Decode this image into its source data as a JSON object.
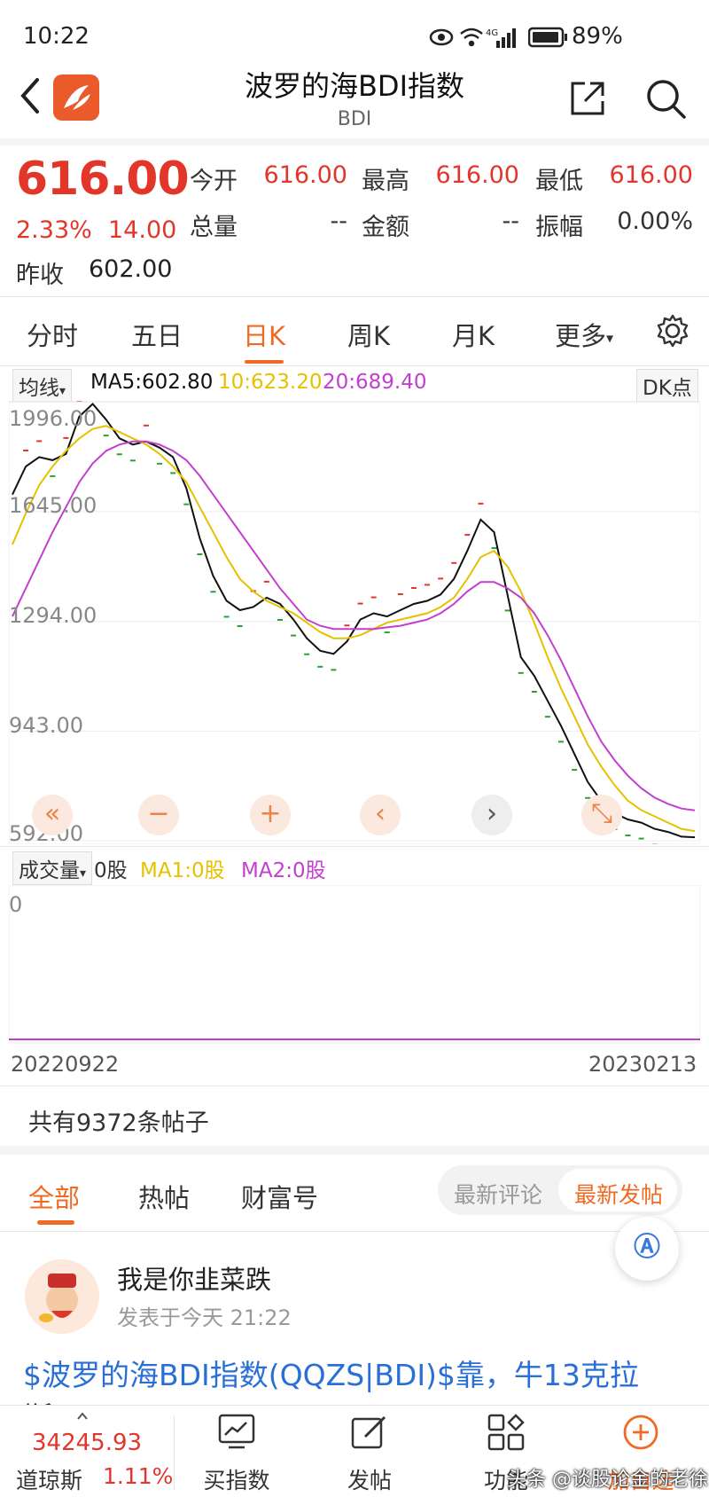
{
  "status_bar": {
    "time": "10:22",
    "network": "4G",
    "battery": "89%"
  },
  "header": {
    "title": "波罗的海BDI指数",
    "subtitle": "BDI"
  },
  "quote": {
    "price": "616.00",
    "change_pct": "2.33%",
    "change": "14.00",
    "prev_close_label": "昨收",
    "prev_close": "602.00",
    "open_label": "今开",
    "open": "616.00",
    "high_label": "最高",
    "high": "616.00",
    "low_label": "最低",
    "low": "616.00",
    "volume_label": "总量",
    "volume": "--",
    "amount_label": "金额",
    "amount": "--",
    "amplitude_label": "振幅",
    "amplitude": "0.00%"
  },
  "chart_tabs": [
    {
      "label": "分时"
    },
    {
      "label": "五日"
    },
    {
      "label": "日K"
    },
    {
      "label": "周K"
    },
    {
      "label": "月K"
    },
    {
      "label": "更多"
    }
  ],
  "ma_bar": {
    "selector": "均线",
    "ma5": "MA5:602.80",
    "ma10": "10:623.20",
    "ma20": "20:689.40",
    "dk_button": "DK点"
  },
  "vol_bar": {
    "selector": "成交量",
    "vol": "0股",
    "ma1": "MA1:0股",
    "ma2": "MA2:0股"
  },
  "colors": {
    "up": "#e2362b",
    "down": "#2aa137",
    "accent": "#f06a23",
    "ma5": "#111111",
    "ma10": "#e6c100",
    "ma20": "#c23fcf"
  },
  "chart_data": {
    "type": "line",
    "y_ticks": [
      "1996.00",
      "1645.00",
      "1294.00",
      "943.00",
      "592.00"
    ],
    "ylim": [
      592,
      2000
    ],
    "vol_ticks": [
      "0"
    ],
    "x_labels": [
      "20220922",
      "20230213"
    ],
    "series": [
      {
        "name": "MA5",
        "values": [
          1700,
          1790,
          1820,
          1810,
          1830,
          1950,
          1990,
          1940,
          1880,
          1860,
          1870,
          1850,
          1820,
          1720,
          1560,
          1440,
          1360,
          1330,
          1340,
          1370,
          1350,
          1300,
          1240,
          1200,
          1190,
          1230,
          1300,
          1320,
          1310,
          1330,
          1350,
          1360,
          1380,
          1430,
          1520,
          1620,
          1580,
          1380,
          1180,
          1120,
          1040,
          960,
          870,
          780,
          720,
          680,
          660,
          650,
          630,
          620,
          605,
          603
        ]
      },
      {
        "name": "10",
        "values": [
          1540,
          1640,
          1730,
          1790,
          1840,
          1880,
          1910,
          1920,
          1900,
          1880,
          1860,
          1830,
          1790,
          1740,
          1660,
          1580,
          1500,
          1430,
          1390,
          1360,
          1340,
          1320,
          1290,
          1260,
          1240,
          1240,
          1250,
          1270,
          1290,
          1300,
          1310,
          1320,
          1340,
          1370,
          1430,
          1500,
          1520,
          1470,
          1390,
          1290,
          1180,
          1080,
          990,
          900,
          830,
          770,
          720,
          690,
          670,
          650,
          630,
          623
        ]
      },
      {
        "name": "20",
        "values": [
          1310,
          1400,
          1490,
          1580,
          1660,
          1740,
          1800,
          1840,
          1860,
          1870,
          1870,
          1860,
          1840,
          1810,
          1760,
          1700,
          1640,
          1580,
          1520,
          1460,
          1400,
          1350,
          1300,
          1280,
          1270,
          1270,
          1270,
          1270,
          1275,
          1280,
          1290,
          1300,
          1320,
          1350,
          1390,
          1420,
          1420,
          1400,
          1370,
          1320,
          1250,
          1170,
          1080,
          990,
          910,
          850,
          800,
          760,
          730,
          710,
          695,
          689
        ]
      }
    ],
    "volume": [
      0
    ]
  },
  "chart_controls": [
    {
      "icon": "double-left-icon",
      "glyph": "«"
    },
    {
      "icon": "zoom-out-icon",
      "glyph": "−"
    },
    {
      "icon": "zoom-in-icon",
      "glyph": "+"
    },
    {
      "icon": "step-left-icon",
      "glyph": "‹"
    },
    {
      "icon": "step-right-icon",
      "glyph": "›"
    },
    {
      "icon": "expand-icon",
      "glyph": "⤡"
    }
  ],
  "posts": {
    "count_text": "共有9372条帖子",
    "tabs": [
      {
        "label": "全部"
      },
      {
        "label": "热帖"
      },
      {
        "label": "财富号"
      }
    ],
    "sort": {
      "latest_comment": "最新评论",
      "latest_post": "最新发帖"
    },
    "items": [
      {
        "author": "我是你韭菜跌",
        "meta": "发表于今天 21:22",
        "content": "$波罗的海BDI指数(QQZS|BDI)$靠，牛13克拉",
        "content_cont": "斯"
      }
    ]
  },
  "bottom_bar": {
    "index_value": "34245.93",
    "index_name": "道琼斯",
    "index_change": "1.11%",
    "items": [
      {
        "label": "买指数",
        "icon": "chart-trend-icon"
      },
      {
        "label": "发帖",
        "icon": "edit-icon"
      },
      {
        "label": "功能",
        "icon": "grid-icon"
      },
      {
        "label": "加自选",
        "icon": "add-circle-icon"
      }
    ]
  },
  "watermark": "头条 @谈股论金的老徐"
}
